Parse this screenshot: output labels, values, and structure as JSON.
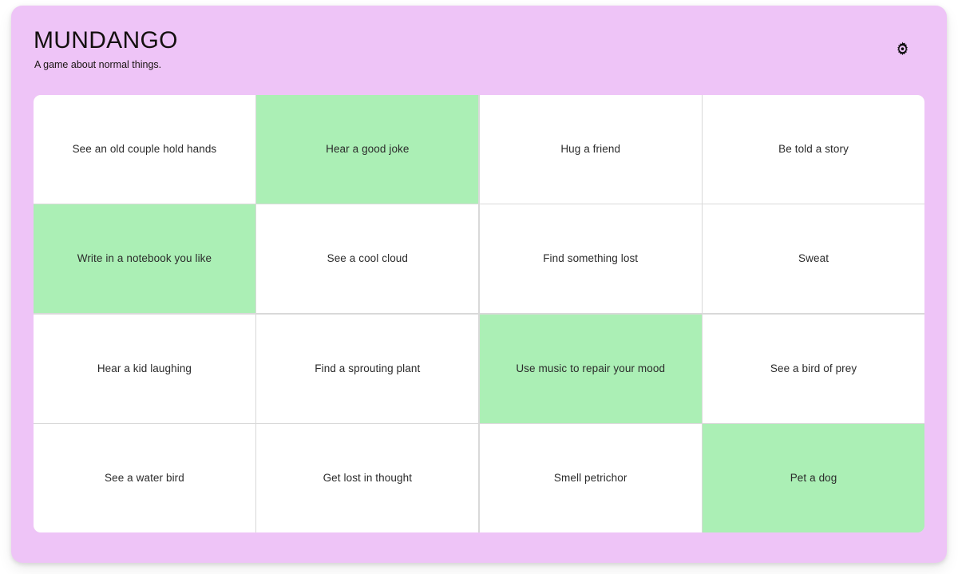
{
  "header": {
    "title": "MUNDANGO",
    "subtitle": "A game about normal things.",
    "settings_icon": "gear-icon"
  },
  "theme": {
    "page_background": "#ffffff",
    "card_background": "#eec4f7",
    "cell_background": "#ffffff",
    "cell_marked_background": "#abefb5",
    "grid_line": "#d9d9d9",
    "text": "#2b2b2b",
    "title_text": "#14100f"
  },
  "board": {
    "columns": 4,
    "rows": 4,
    "cells": [
      {
        "label": "See an old couple hold hands",
        "marked": false
      },
      {
        "label": "Hear a good joke",
        "marked": true
      },
      {
        "label": "Hug a friend",
        "marked": false
      },
      {
        "label": "Be told a story",
        "marked": false
      },
      {
        "label": "Write in a notebook you like",
        "marked": true
      },
      {
        "label": "See a cool cloud",
        "marked": false
      },
      {
        "label": "Find something lost",
        "marked": false
      },
      {
        "label": "Sweat",
        "marked": false
      },
      {
        "label": "Hear a kid laughing",
        "marked": false
      },
      {
        "label": "Find a sprouting plant",
        "marked": false
      },
      {
        "label": "Use music to repair your mood",
        "marked": true
      },
      {
        "label": "See a bird of prey",
        "marked": false
      },
      {
        "label": "See a water bird",
        "marked": false
      },
      {
        "label": "Get lost in thought",
        "marked": false
      },
      {
        "label": "Smell petrichor",
        "marked": false
      },
      {
        "label": "Pet a dog",
        "marked": true
      }
    ]
  }
}
